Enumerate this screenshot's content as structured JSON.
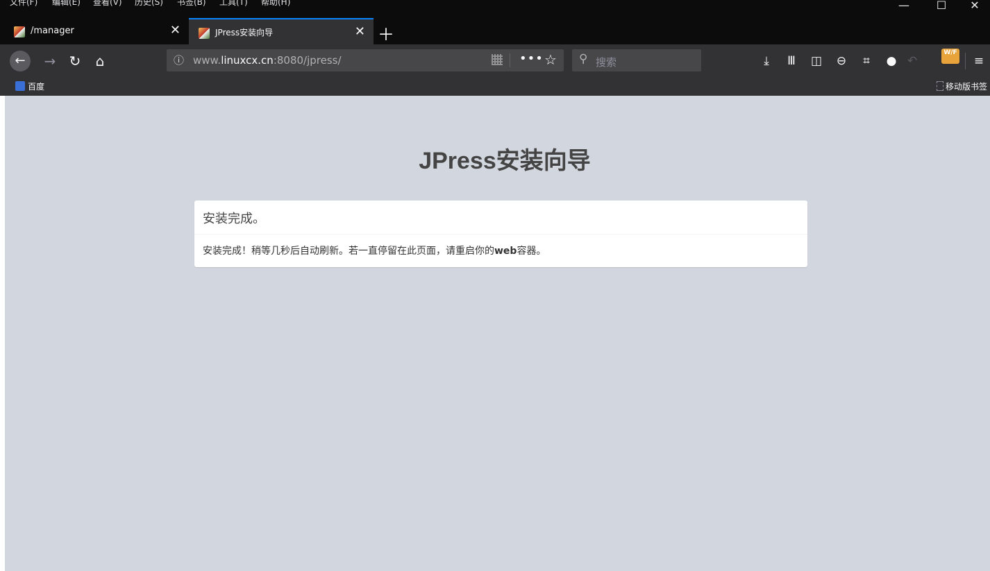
{
  "window": {
    "menu": [
      "文件(F)",
      "编辑(E)",
      "查看(V)",
      "历史(S)",
      "书签(B)",
      "工具(T)",
      "帮助(H)"
    ],
    "controls": {
      "minimize": "—",
      "maximize": "☐",
      "close": "✕"
    }
  },
  "tabs": [
    {
      "title": "/manager",
      "active": false
    },
    {
      "title": "JPress安装向导",
      "active": true
    }
  ],
  "toolbar": {
    "url_prefix": "www.",
    "url_domain": "linuxcx.cn",
    "url_rest": ":8080/jpress/",
    "search_placeholder": "搜索",
    "wf_badge": "W/F"
  },
  "bookmarks": {
    "items": [
      "百度"
    ],
    "mobile": "移动版书签"
  },
  "page": {
    "title": "JPress安装向导",
    "box_title": "安装完成。",
    "body_text_1": "安装完成！稍等几秒后自动刷新。若一直停留在此页面，请重启你的",
    "body_bold": "web",
    "body_text_2": "容器。"
  },
  "colors": {
    "page_background": "#d2d6de",
    "browser_chrome": "#0c0c0d",
    "toolbar": "#323234",
    "active_tab_accent": "#0a84ff"
  }
}
